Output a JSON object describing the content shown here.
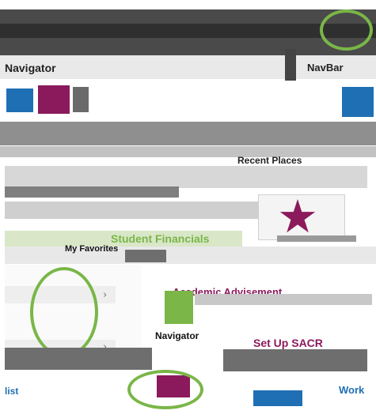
{
  "header": {
    "title": "",
    "right_label": "NavBar"
  },
  "navigator_panel": {
    "title": "Navigator"
  },
  "recent_places": {
    "title": "Recent Places"
  },
  "student_banner": {
    "title": "Student Financials"
  },
  "my_favorites": {
    "title": "My Favorites"
  },
  "favorites_tile": {
    "title": "Academic Advisement"
  },
  "navigator_tile": {
    "title": "Navigator"
  },
  "setup_tile": {
    "title": "Set Up SACR"
  },
  "footer": {
    "left_label": "list",
    "right_label": "Work"
  },
  "colors": {
    "accent_green": "#7ab648",
    "brand_purple": "#8b1a5c",
    "link_blue": "#1f6fb5"
  },
  "icons": [
    "star-icon",
    "chevron-right-icon",
    "navigator-icon",
    "menu-icon"
  ]
}
